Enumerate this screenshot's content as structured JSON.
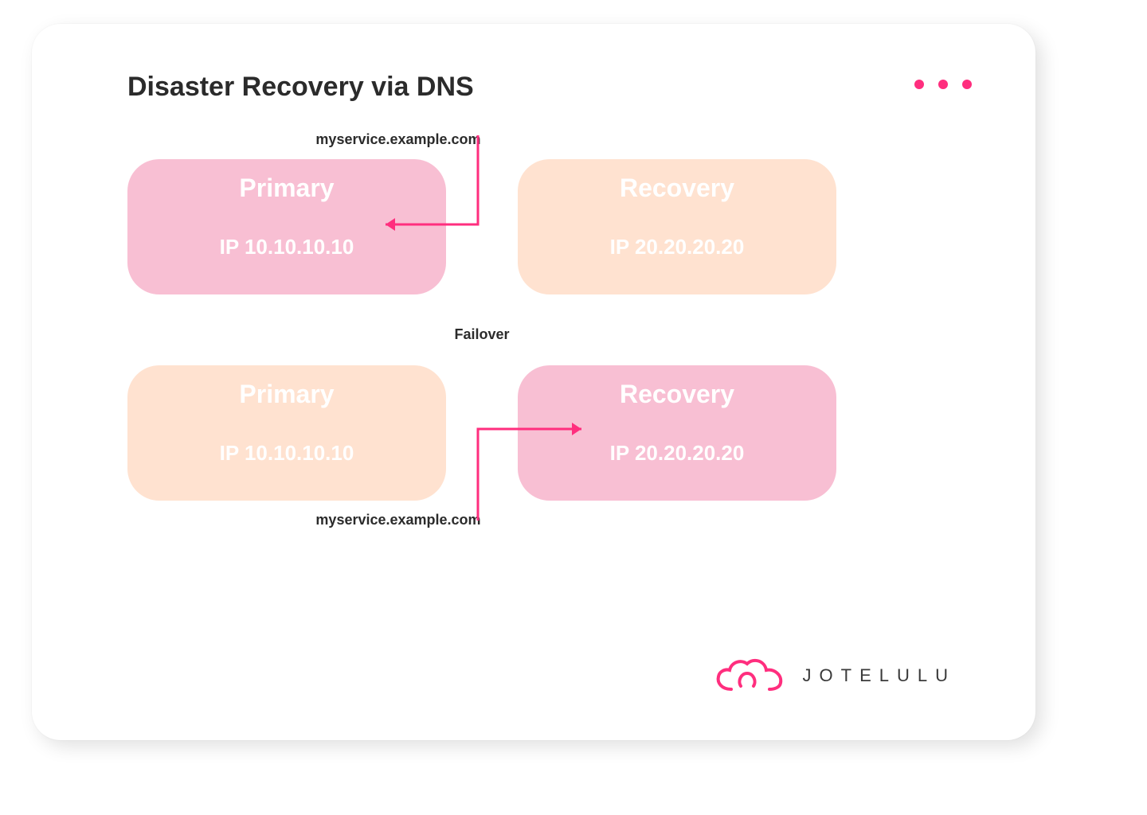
{
  "title": "Disaster Recovery via DNS",
  "domain": "myservice.example.com",
  "failover_label": "Failover",
  "states": {
    "before": {
      "primary": {
        "title": "Primary",
        "ip": "IP 10.10.10.10",
        "active": true
      },
      "recovery": {
        "title": "Recovery",
        "ip": "IP 20.20.20.20",
        "active": false
      }
    },
    "after": {
      "primary": {
        "title": "Primary",
        "ip": "IP 10.10.10.10",
        "active": false
      },
      "recovery": {
        "title": "Recovery",
        "ip": "IP 20.20.20.20",
        "active": true
      }
    }
  },
  "brand": "JOTELULU",
  "colors": {
    "accent": "#ff2e7e",
    "active_box": "#f8bfd3",
    "inactive_box": "#ffe2d0"
  }
}
